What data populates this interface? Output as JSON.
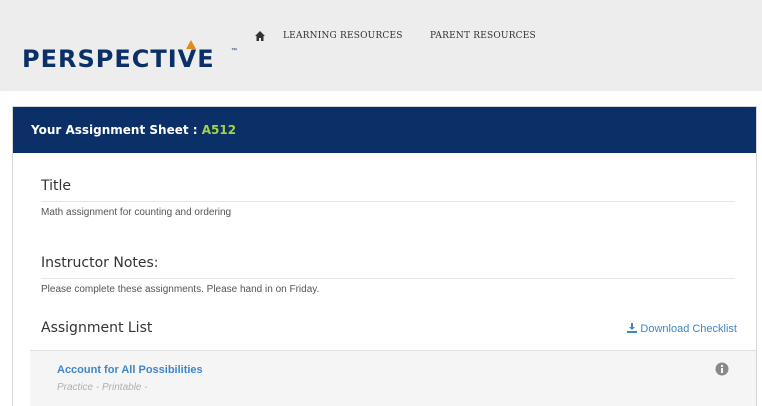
{
  "header": {
    "logo_text": "PERSPECTIVE",
    "logo_tm": "™",
    "nav": {
      "home_icon": "home-icon",
      "learning_resources": "LEARNING RESOURCES",
      "parent_resources": "PARENT RESOURCES"
    }
  },
  "assignment_sheet": {
    "title_label": "Your Assignment Sheet : ",
    "code": "A512",
    "sections": {
      "title_heading": "Title",
      "title_text": "Math assignment for counting and ordering",
      "notes_heading": "Instructor Notes:",
      "notes_text": "Please complete these assignments. Please hand in on Friday.",
      "list_heading": "Assignment List",
      "download_label": "Download Checklist",
      "download_icon": "download-icon"
    },
    "assignments": [
      {
        "name": "Account for All Possibilities",
        "meta": "Practice  -  Printable  -",
        "info_icon": "info-icon"
      }
    ]
  },
  "colors": {
    "brand_navy": "#0b2f67",
    "accent_orange": "#e58a1f",
    "code_green": "#a4d34a",
    "link_blue": "#3f86c9"
  }
}
